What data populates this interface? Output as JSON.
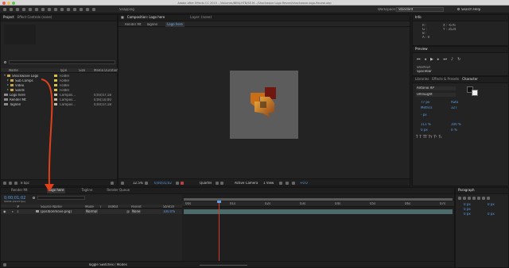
{
  "window": {
    "title": "Adobe After Effects CC 2015 - /Volumes/BENJ-HTB/SE.M.../Shockwave Logo Reveal/shockwave-logo-Reveal.aep",
    "search_tab": "Snapping",
    "workspace_label": "Workspace:",
    "workspace_value": "Standard",
    "search_help": "Search Help"
  },
  "project": {
    "tab_project": "Project",
    "tab_effect": "Effect Controls (none)",
    "search_icon": "magnifier",
    "columns": {
      "name": "Name",
      "type": "Type",
      "size": "Size",
      "duration": "Media Duration"
    },
    "rows": [
      {
        "name": "Shockwave Logo",
        "type": "Folder",
        "size": "",
        "duration": "",
        "color": "#d7c14a"
      },
      {
        "name": "Sub Comps",
        "type": "Folder",
        "size": "",
        "duration": "",
        "color": "#d7c14a"
      },
      {
        "name": "Video",
        "type": "Folder",
        "size": "",
        "duration": "",
        "color": "#d7c14a"
      },
      {
        "name": "Solids",
        "type": "Folder",
        "size": "",
        "duration": "",
        "color": "#d7c14a"
      },
      {
        "name": "Logo here",
        "type": "Compos...",
        "size": "",
        "duration": "0;00;07;18",
        "color": "#c8b8a0"
      },
      {
        "name": "Render Mt",
        "type": "Compos...",
        "size": "",
        "duration": "0;00;10;00",
        "color": "#c8b8a0"
      },
      {
        "name": "Tagline",
        "type": "Compos...",
        "size": "",
        "duration": "0;00;07;18",
        "color": "#c8b8a0"
      }
    ],
    "bpc": "8 bpc"
  },
  "composition": {
    "header": "Composition: Logo here",
    "layer_tab": "Layer: (none)",
    "subtabs": [
      "Render Mt",
      "Tagline",
      "Logo here"
    ],
    "zoom": "12.5%",
    "time": "0;00;01;02",
    "quality": "Quarter",
    "camera": "Active Camera",
    "view": "1 View",
    "exposure": "+0.0"
  },
  "info": {
    "tab": "Info",
    "r": "R :",
    "g": "G :",
    "b": "B :",
    "a": "A : 0",
    "x": "X : -676",
    "y": "Y : 3524"
  },
  "preview": {
    "tab": "Preview",
    "shortcut_label": "Shortcut",
    "shortcut_value": "Spacebar"
  },
  "right_tabs": [
    "Libraries",
    "Effects & Presets",
    "Character"
  ],
  "character": {
    "font": "Antonio RP",
    "style": "UltraLight",
    "size": "77 px",
    "leading": "Auto",
    "tracking": "Metrics",
    "kerning": "327",
    "stroke": "- px",
    "vscale": "111 %",
    "hscale": "100 %",
    "baseline": "0 px",
    "tsume": "0 %"
  },
  "timeline": {
    "tabs": [
      "Render Mt",
      "Logo here",
      "Tagline",
      "Render Queue"
    ],
    "timecode": "0;00;01;02",
    "fps": "00032 (29.97 fps)",
    "columns": {
      "num": "#",
      "source": "Source Name",
      "mode": "Mode",
      "t": "T",
      "trkmat": "TrkMat",
      "parent": "Parent",
      "stretch": "Stretch"
    },
    "layer": {
      "num": "1",
      "name": "[positionmove.png]",
      "mode": "Normal",
      "parent": "None",
      "stretch": "100.0%"
    },
    "ruler": [
      "00s",
      "01s",
      "02s",
      "03s",
      "04s",
      "05s",
      "06s",
      "07s"
    ],
    "toggle_label": "Toggle Switches / Modes"
  },
  "paragraph": {
    "tab": "Paragraph",
    "indent_left": "0 px",
    "indent_right": "0 px",
    "indent_first": "0 px",
    "space_before": "0 px",
    "space_after": "0 px"
  },
  "colors": {
    "accent": "#5aa0e8",
    "annotation_arrow": "#e0401a",
    "logo_orange": "#d98a1c",
    "logo_red": "#7a1a12"
  }
}
